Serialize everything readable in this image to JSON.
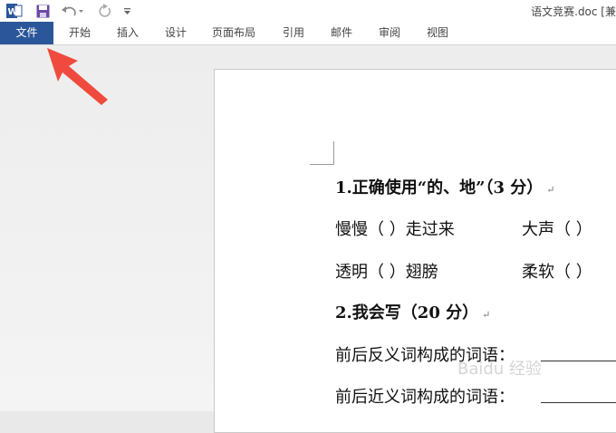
{
  "title_bar": {
    "doc_title": "语文竞赛.doc [兼"
  },
  "quick_access": {
    "word_icon": "word-app-icon",
    "save_icon": "save-icon",
    "undo_icon": "undo-icon",
    "redo_icon": "redo-icon",
    "customize_icon": "customize-quick-access-icon"
  },
  "ribbon": {
    "tabs": [
      "文件",
      "开始",
      "插入",
      "设计",
      "页面布局",
      "引用",
      "邮件",
      "审阅",
      "视图"
    ],
    "accent": "#2b579a"
  },
  "annotation": {
    "arrow_color": "#f04a3e"
  },
  "document": {
    "q1_title": "1.正确使用“的、地”（3 分）",
    "q1_line1_a": "慢慢（    ）走过来",
    "q1_line1_b": "大声（    ）",
    "q1_line2_a": "透明（    ）翅膀",
    "q1_line2_b": "柔软（    ）",
    "q2_title": "2.我会写（20 分）",
    "q2_line1": "前后反义词构成的词语：",
    "q2_line2": "前后近义词构成的词语：",
    "paragraph_mark": "↵"
  },
  "watermark": "Baidu 经验"
}
